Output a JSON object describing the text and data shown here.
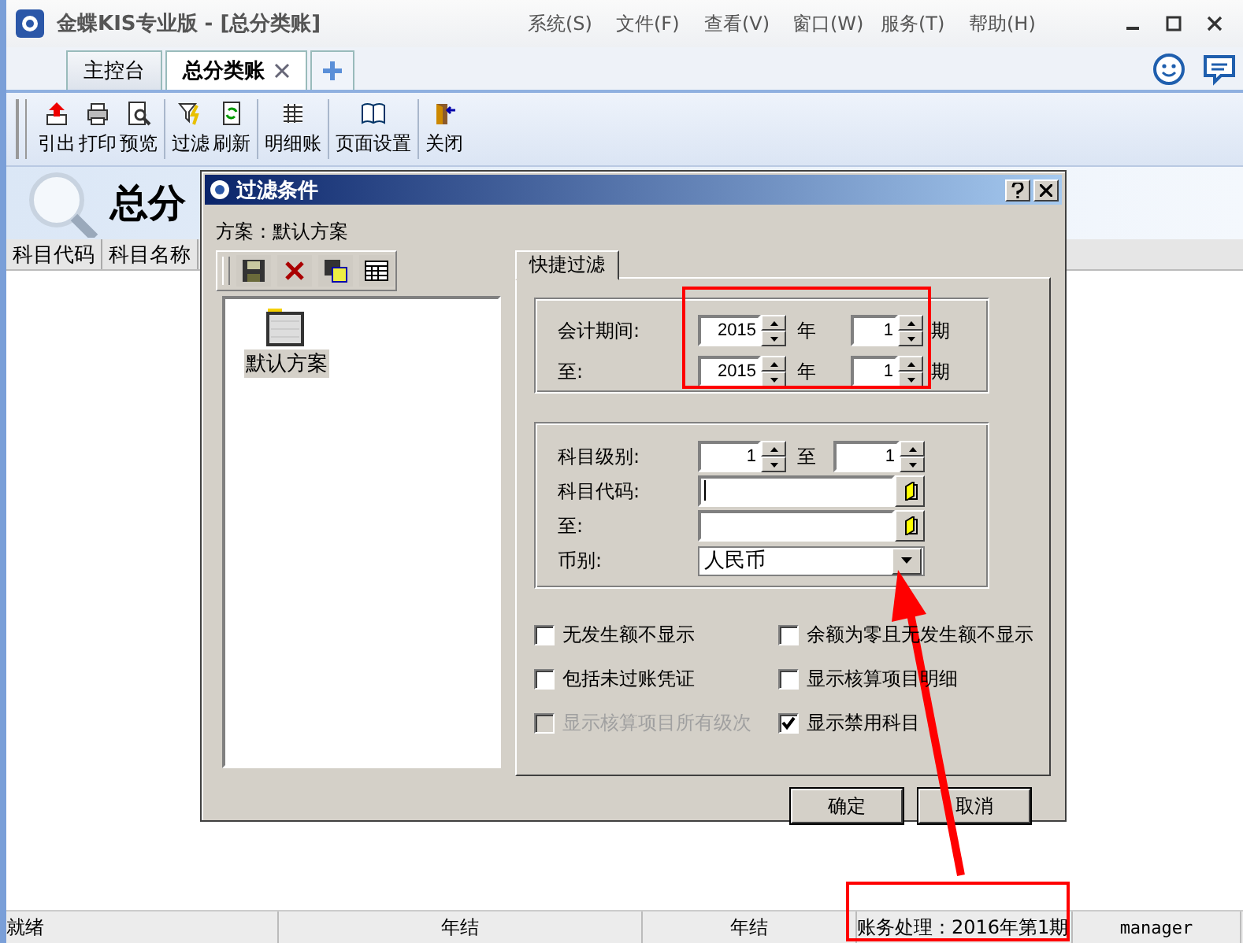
{
  "window": {
    "title": "金蝶KIS专业版 - [总分类账]",
    "menus": [
      "系统(S)",
      "文件(F)",
      "查看(V)",
      "窗口(W)",
      "服务(T)",
      "帮助(H)"
    ]
  },
  "tabs": [
    {
      "label": "主控台",
      "selected": false,
      "closable": false
    },
    {
      "label": "总分类账",
      "selected": true,
      "closable": true
    }
  ],
  "toolbar": [
    [
      {
        "label": "引出"
      },
      {
        "label": "打印"
      },
      {
        "label": "预览"
      }
    ],
    [
      {
        "label": "过滤"
      },
      {
        "label": "刷新"
      }
    ],
    [
      {
        "label": "明细账"
      }
    ],
    [
      {
        "label": "页面设置"
      }
    ],
    [
      {
        "label": "关闭"
      }
    ]
  ],
  "report": {
    "title": "总分",
    "columns": [
      "科目代码",
      "科目名称"
    ]
  },
  "dialog": {
    "title": "过滤条件",
    "scheme_label": "方案：默认方案",
    "schemes": [
      {
        "label": "默认方案",
        "selected": true
      }
    ],
    "tabs": [
      {
        "label": "快捷过滤",
        "selected": true
      }
    ],
    "period_rows": [
      {
        "label": "会计期间:",
        "year": "2015",
        "year_unit": "年",
        "period": "1",
        "period_unit": "期"
      },
      {
        "label": "至:",
        "year": "2015",
        "year_unit": "年",
        "period": "1",
        "period_unit": "期"
      }
    ],
    "level": {
      "label": "科目级别:",
      "from": "1",
      "separator": "至",
      "to": "1"
    },
    "code_fields": [
      {
        "label": "科目代码:",
        "focused": true
      },
      {
        "label": "至:",
        "focused": false
      }
    ],
    "currency": {
      "label": "币别:",
      "value": "人民币"
    },
    "options": [
      {
        "label": "无发生额不显示",
        "checked": false,
        "disabled": false
      },
      {
        "label": "余额为零且无发生额不显示",
        "checked": false,
        "disabled": false
      },
      {
        "label": "包括未过账凭证",
        "checked": false,
        "disabled": false
      },
      {
        "label": "显示核算项目明细",
        "checked": false,
        "disabled": false
      },
      {
        "label": "显示核算项目所有级次",
        "checked": false,
        "disabled": true
      },
      {
        "label": "显示禁用科目",
        "checked": true,
        "disabled": false
      }
    ],
    "buttons": [
      "确定",
      "取消"
    ]
  },
  "status_bar": [
    "就绪",
    "年结",
    "年结",
    "账务处理：2016年第1期",
    "manager"
  ]
}
